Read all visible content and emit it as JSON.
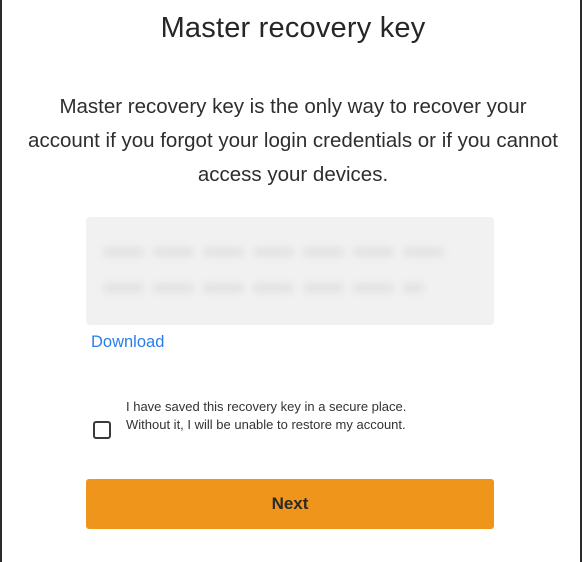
{
  "dialog": {
    "title": "Master recovery key",
    "description": "Master recovery key is the only way to recover your account if you forgot your login credentials or if you cannot access your devices."
  },
  "recovery_key": {
    "lines": [
      "••••  ••••  ••••  ••••  ••••  ••••  ••••",
      "••••  ••••  ••••  ••••  ••••  ••••  ••"
    ],
    "blurred": true
  },
  "download_label": "Download",
  "confirmation": {
    "checked": false,
    "label": "I have saved this recovery key in a secure place. Without it, I will be unable to restore my account."
  },
  "next_label": "Next",
  "colors": {
    "accent": "#ef951c",
    "link": "#2b7de9",
    "key_box_bg": "#f1f1f1"
  }
}
